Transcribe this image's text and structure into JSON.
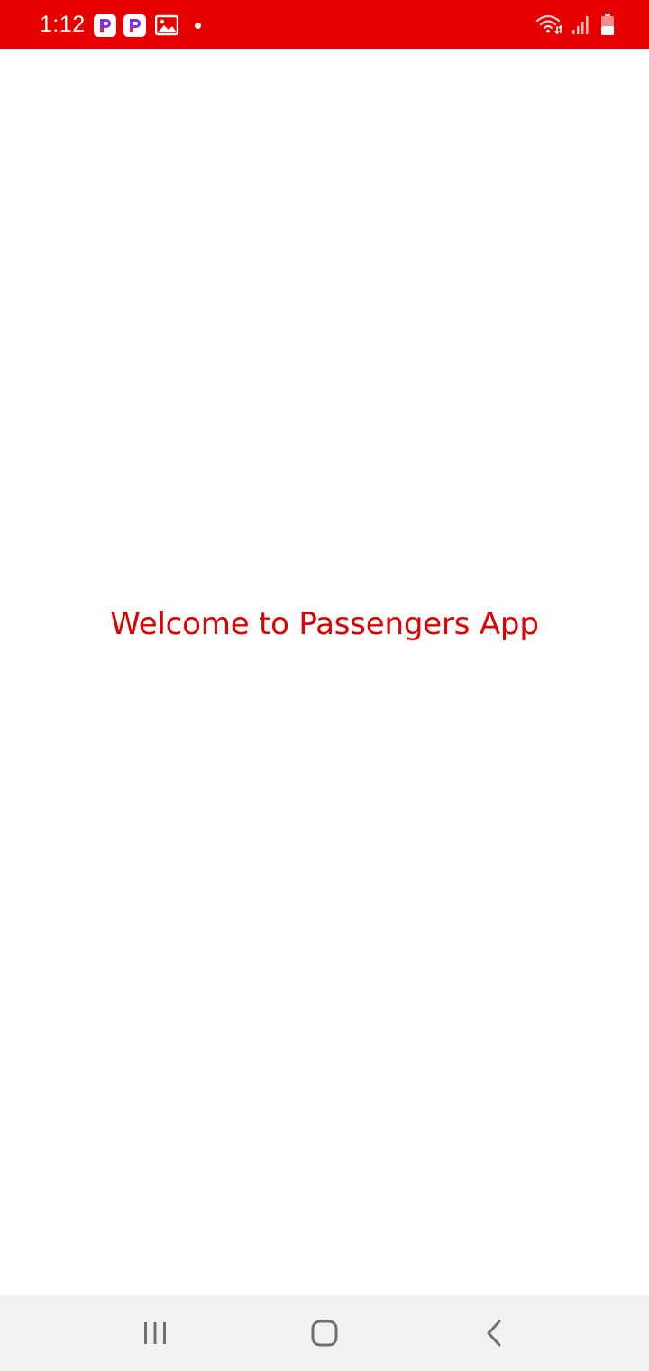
{
  "status_bar": {
    "time": "1:12",
    "background_color": "#e60000",
    "notification_icons": [
      "app-p-icon",
      "app-p-icon",
      "gallery-icon",
      "notification-dot"
    ],
    "system_icons": [
      "wifi-icon",
      "signal-icon",
      "battery-icon"
    ]
  },
  "main": {
    "welcome_text": "Welcome to Passengers App",
    "text_color": "#df0000"
  },
  "nav_bar": {
    "buttons": [
      "recent-apps-icon",
      "home-icon",
      "back-icon"
    ]
  }
}
